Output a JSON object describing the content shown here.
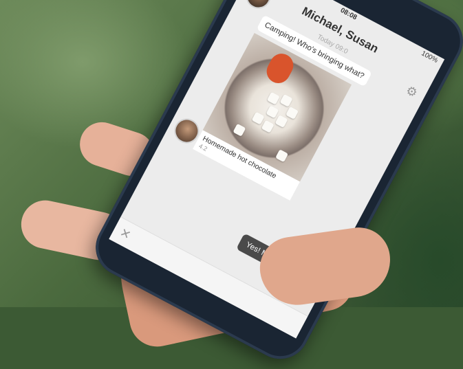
{
  "statusbar": {
    "time": "08:08",
    "battery": "100%"
  },
  "header": {
    "title": "Michael, Susan"
  },
  "thread": {
    "timestamp": "Today 09:0",
    "message_1": "Camping! Who's bringing what?",
    "photo_caption": "Homemade hot chocolate",
    "photo_meta": "4.2",
    "message_out": "Yes! Marsh"
  },
  "icons": {
    "back": "back-arrow-icon",
    "settings": "gear-icon",
    "attach": "attach-icon"
  },
  "colors": {
    "screen_bg": "#ececec",
    "mug": "#d9542c",
    "outgoing_bubble": "#4a4a4a"
  }
}
